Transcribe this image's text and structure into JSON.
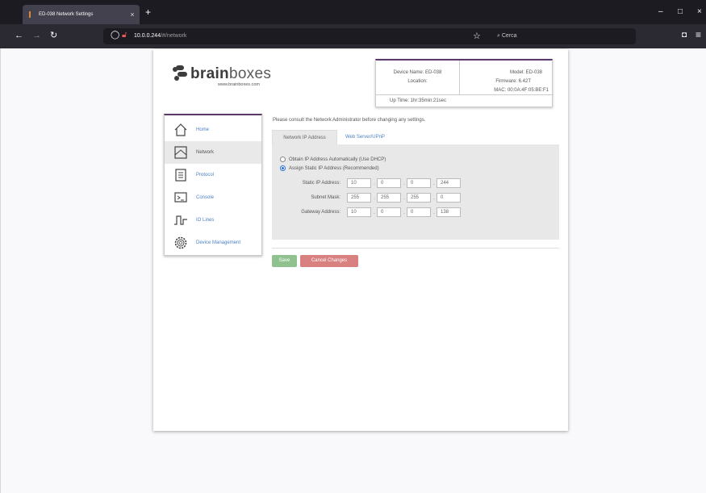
{
  "browser": {
    "tab_title": "ED-038 Network Settings",
    "tab_close": "×",
    "new_tab": "+",
    "url_host": "10.0.0.244",
    "url_path": "/#/network",
    "search_placeholder": "Cerca",
    "win_min": "–",
    "win_max": "□",
    "win_close": "×"
  },
  "logo": {
    "word_bold": "brain",
    "word_light": "boxes",
    "url": "www.brainboxes.com"
  },
  "device_info": {
    "device_name": "Device Name: ED-038",
    "location": "Location:",
    "model": "Model: ED-038",
    "firmware": "Firmware: 6.42T",
    "mac": "MAC: 00:0A:4F:05:BE:F1",
    "uptime": "Up Time: 1hr:35min:21sec"
  },
  "sidebar": {
    "items": [
      {
        "label": "Home",
        "icon": "house-icon"
      },
      {
        "label": "Network",
        "icon": "network-icon"
      },
      {
        "label": "Protocol",
        "icon": "document-icon"
      },
      {
        "label": "Console",
        "icon": "console-icon"
      },
      {
        "label": "IO Lines",
        "icon": "io-lines-icon"
      },
      {
        "label": "Device Management",
        "icon": "gear-icon"
      }
    ],
    "active": "Network"
  },
  "main": {
    "notice": "Please consult the Network Administrator before changing any settings.",
    "tabs": [
      "Network IP Address",
      "Web Server/UPnP"
    ],
    "radio_dhcp": "Obtain IP Address Automatically (Use DHCP)",
    "radio_static": "Assign Static IP Address (Recommended)",
    "selected_mode": "static",
    "static_ip_label": "Static IP Address:",
    "subnet_label": "Subnet Mask:",
    "gateway_label": "Gateway Address:",
    "static_ip": [
      "10",
      "0",
      "0",
      "244"
    ],
    "subnet": [
      "255",
      "255",
      "255",
      "0"
    ],
    "gateway": [
      "10",
      "0",
      "0",
      "138"
    ],
    "dot": "."
  },
  "buttons": {
    "save": "Save",
    "cancel": "Cancel Changes"
  },
  "colors": {
    "accent": "#5b3a6b",
    "link": "#4a82c3",
    "save": "#8fc28f",
    "cancel": "#d98080"
  }
}
